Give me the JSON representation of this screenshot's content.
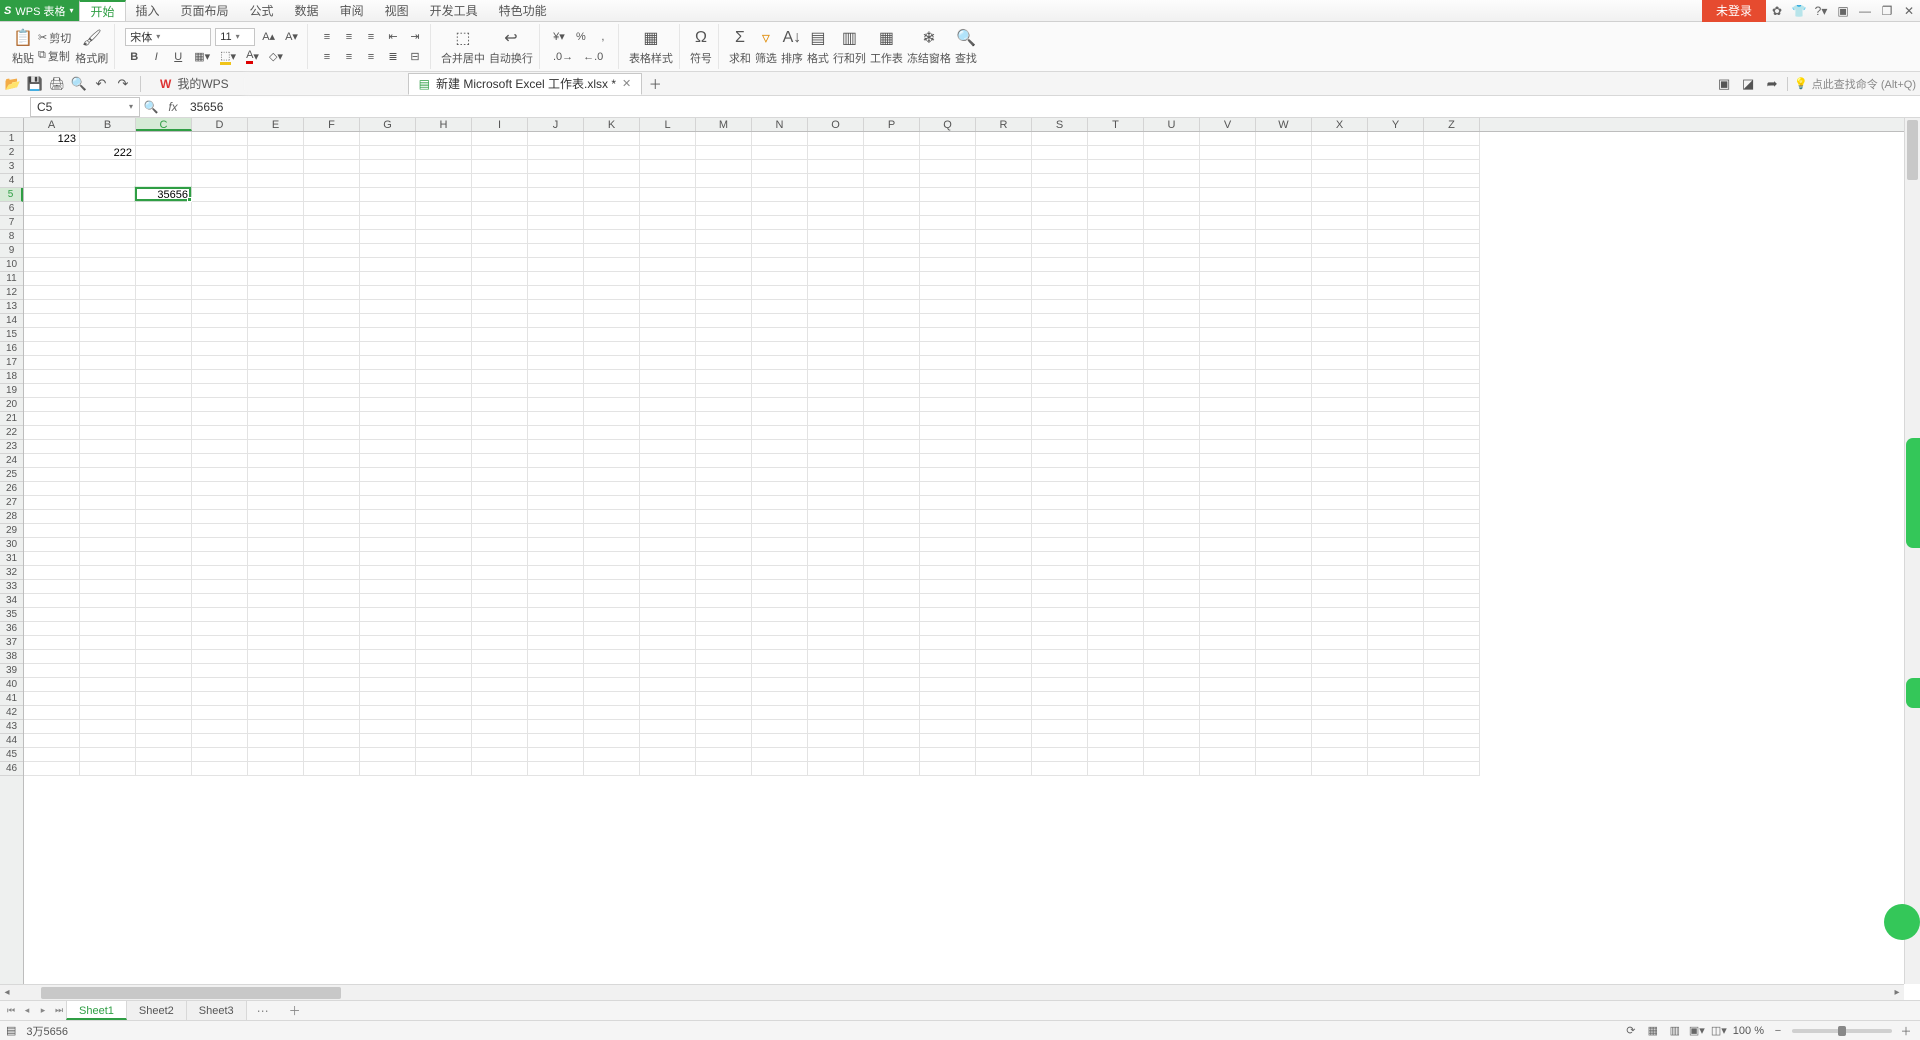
{
  "app": {
    "name": "WPS 表格"
  },
  "menu": [
    "开始",
    "插入",
    "页面布局",
    "公式",
    "数据",
    "审阅",
    "视图",
    "开发工具",
    "特色功能"
  ],
  "menu_active": 0,
  "login_label": "未登录",
  "ribbon": {
    "paste": "粘贴",
    "cut": "剪切",
    "copy": "复制",
    "format_painter": "格式刷",
    "font_name": "宋体",
    "font_size": "11",
    "merge_center": "合并居中",
    "wrap_text": "自动换行",
    "table_style": "表格样式",
    "symbol": "符号",
    "sum": "求和",
    "filter": "筛选",
    "sort": "排序",
    "format": "格式",
    "row_col": "行和列",
    "worksheet": "工作表",
    "freeze": "冻结窗格",
    "find": "查找"
  },
  "doc_tabs": {
    "home": "我的WPS",
    "active": "新建 Microsoft Excel 工作表.xlsx *"
  },
  "search_hint": "点此查找命令 (Alt+Q)",
  "formula_bar": {
    "name_box": "C5",
    "value": "35656"
  },
  "columns": [
    "A",
    "B",
    "C",
    "D",
    "E",
    "F",
    "G",
    "H",
    "I",
    "J",
    "K",
    "L",
    "M",
    "N",
    "O",
    "P",
    "Q",
    "R",
    "S",
    "T",
    "U",
    "V",
    "W",
    "X",
    "Y",
    "Z"
  ],
  "row_count": 46,
  "selected": {
    "col": 2,
    "row": 4
  },
  "cells": {
    "A1": "123",
    "B2": "222",
    "C5": "35656"
  },
  "sheets": [
    "Sheet1",
    "Sheet2",
    "Sheet3"
  ],
  "sheet_active": 0,
  "status": {
    "text": "3万5656",
    "zoom": "100 %"
  }
}
